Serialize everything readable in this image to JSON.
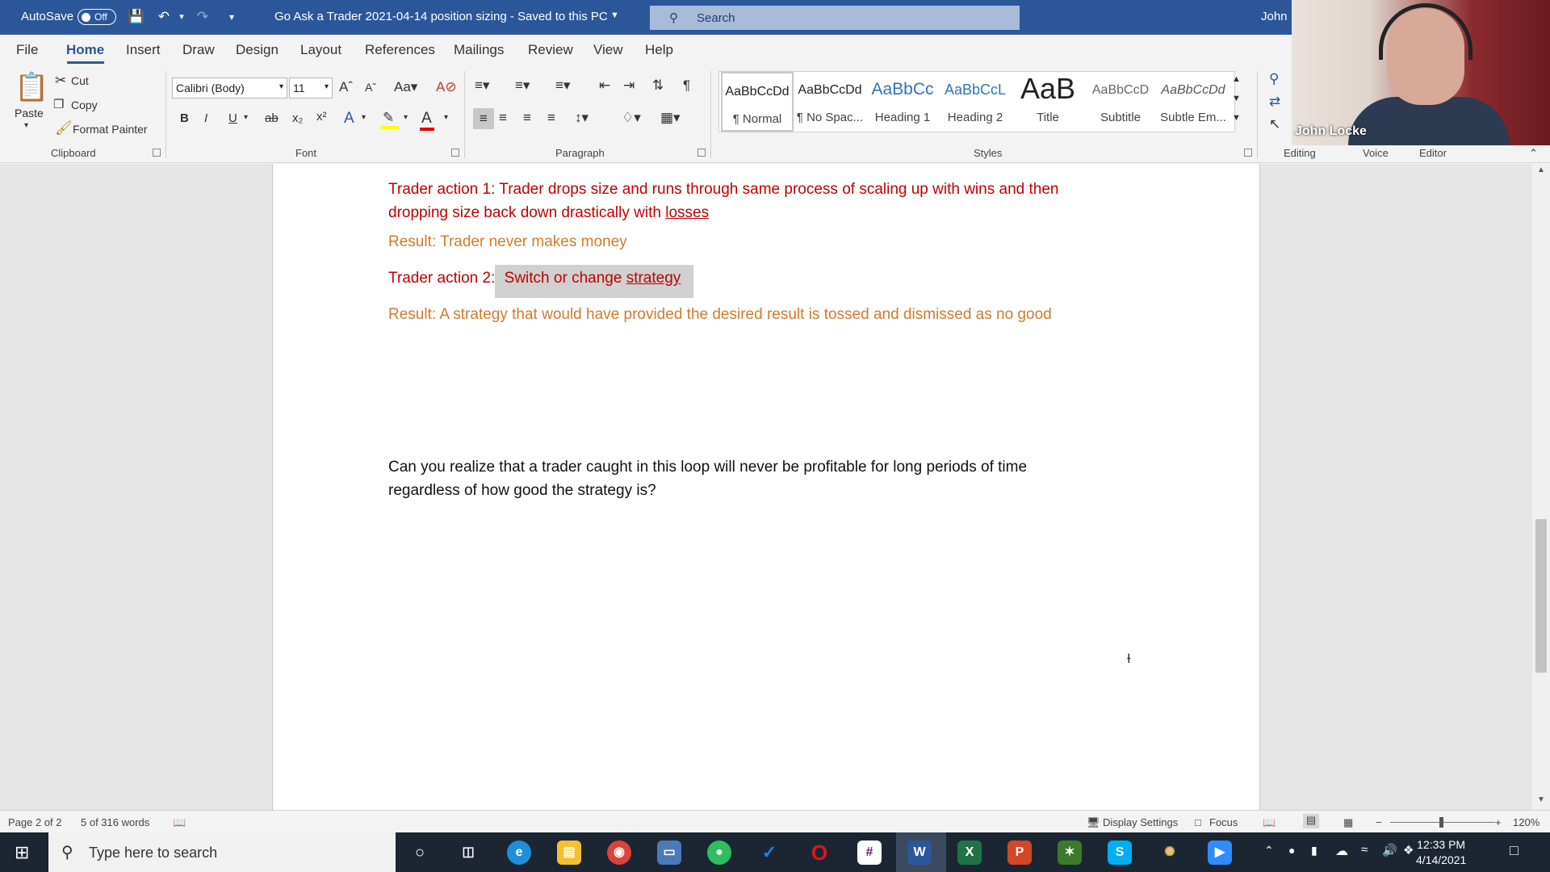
{
  "titlebar": {
    "autosave_label": "AutoSave",
    "autosave_state": "Off",
    "document_title": "Go Ask a Trader 2021-04-14 position sizing  -  Saved to this PC",
    "search_placeholder": "Search",
    "user_name": "John L"
  },
  "tabs": [
    "File",
    "Home",
    "Insert",
    "Draw",
    "Design",
    "Layout",
    "References",
    "Mailings",
    "Review",
    "View",
    "Help"
  ],
  "ribbon": {
    "clipboard": {
      "paste": "Paste",
      "cut": "Cut",
      "copy": "Copy",
      "format_painter": "Format Painter",
      "label": "Clipboard"
    },
    "font": {
      "family": "Calibri (Body)",
      "size": "11",
      "label": "Font"
    },
    "paragraph": {
      "label": "Paragraph"
    },
    "styles": {
      "label": "Styles",
      "items": [
        {
          "preview": "AaBbCcDd",
          "name": "¶ Normal"
        },
        {
          "preview": "AaBbCcDd",
          "name": "¶ No Spac..."
        },
        {
          "preview": "AaBbCc",
          "name": "Heading 1"
        },
        {
          "preview": "AaBbCcL",
          "name": "Heading 2"
        },
        {
          "preview": "AaB",
          "name": "Title"
        },
        {
          "preview": "AaBbCcD",
          "name": "Subtitle"
        },
        {
          "preview": "AaBbCcDd",
          "name": "Subtle Em..."
        }
      ]
    },
    "editing_label": "Editing",
    "voice_label": "Voice",
    "editor_label": "Editor"
  },
  "webcam": {
    "name": "John Locke"
  },
  "document": {
    "action1_text": "Trader action 1: Trader drops size and runs through same process of scaling up with wins and then dropping size back down drastically with ",
    "action1_link": "losses",
    "result1": "Result: Trader never makes money",
    "action2_prefix": "Trader action 2:",
    "action2_highlight": " Switch or change ",
    "action2_link": "strategy",
    "result2": "Result: A strategy that would have provided the desired result is tossed and dismissed as no good",
    "question_line1": "Can you realize that a trader caught in this loop will never be profitable for long periods of time",
    "question_line2": "regardless of how good the strategy is?"
  },
  "statusbar": {
    "page": "Page 2 of 2",
    "words": "5 of 316 words",
    "display_settings": "Display Settings",
    "focus": "Focus",
    "zoom": "120%"
  },
  "taskbar": {
    "search_placeholder": "Type here to search",
    "time": "12:33 PM",
    "date": "4/14/2021"
  },
  "colors": {
    "word_blue": "#2b579a",
    "doc_red": "#c00000",
    "doc_orange": "#d27a2c"
  }
}
